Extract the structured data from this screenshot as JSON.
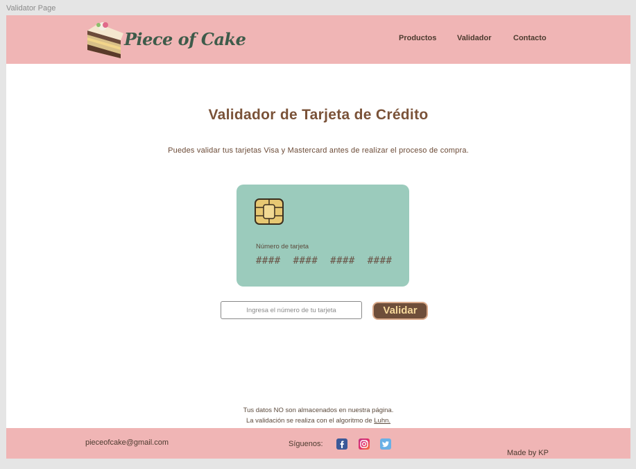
{
  "window": {
    "label": "Validator Page"
  },
  "header": {
    "logo_text": "Piece of Cake",
    "nav": [
      "Productos",
      "Validador",
      "Contacto"
    ]
  },
  "main": {
    "title": "Validador de Tarjeta de Crédito",
    "subtitle": "Puedes validar tus tarjetas Visa y Mastercard antes de realizar el proceso de compra.",
    "card": {
      "label": "Número de tarjeta",
      "number": "####  ####  ####  ####"
    },
    "input_placeholder": "Ingresa el número de tu tarjeta",
    "button_label": "Validar",
    "note_line1": "Tus datos NO son almacenados en nuestra página.",
    "note_line2_prefix": "La validación se realiza con el algoritmo de ",
    "note_link": "Luhn."
  },
  "footer": {
    "email": "pieceofcake@gmail.com",
    "follow": "Síguenos:",
    "made_by": "Made by KP",
    "icons": [
      "facebook-icon",
      "instagram-icon",
      "twitter-icon"
    ]
  },
  "colors": {
    "header_bg": "#f0b5b5",
    "title": "#7a5238",
    "card_bg": "#9bcbbc",
    "button_bg": "#6e4e3a",
    "button_text": "#f6d89b"
  }
}
